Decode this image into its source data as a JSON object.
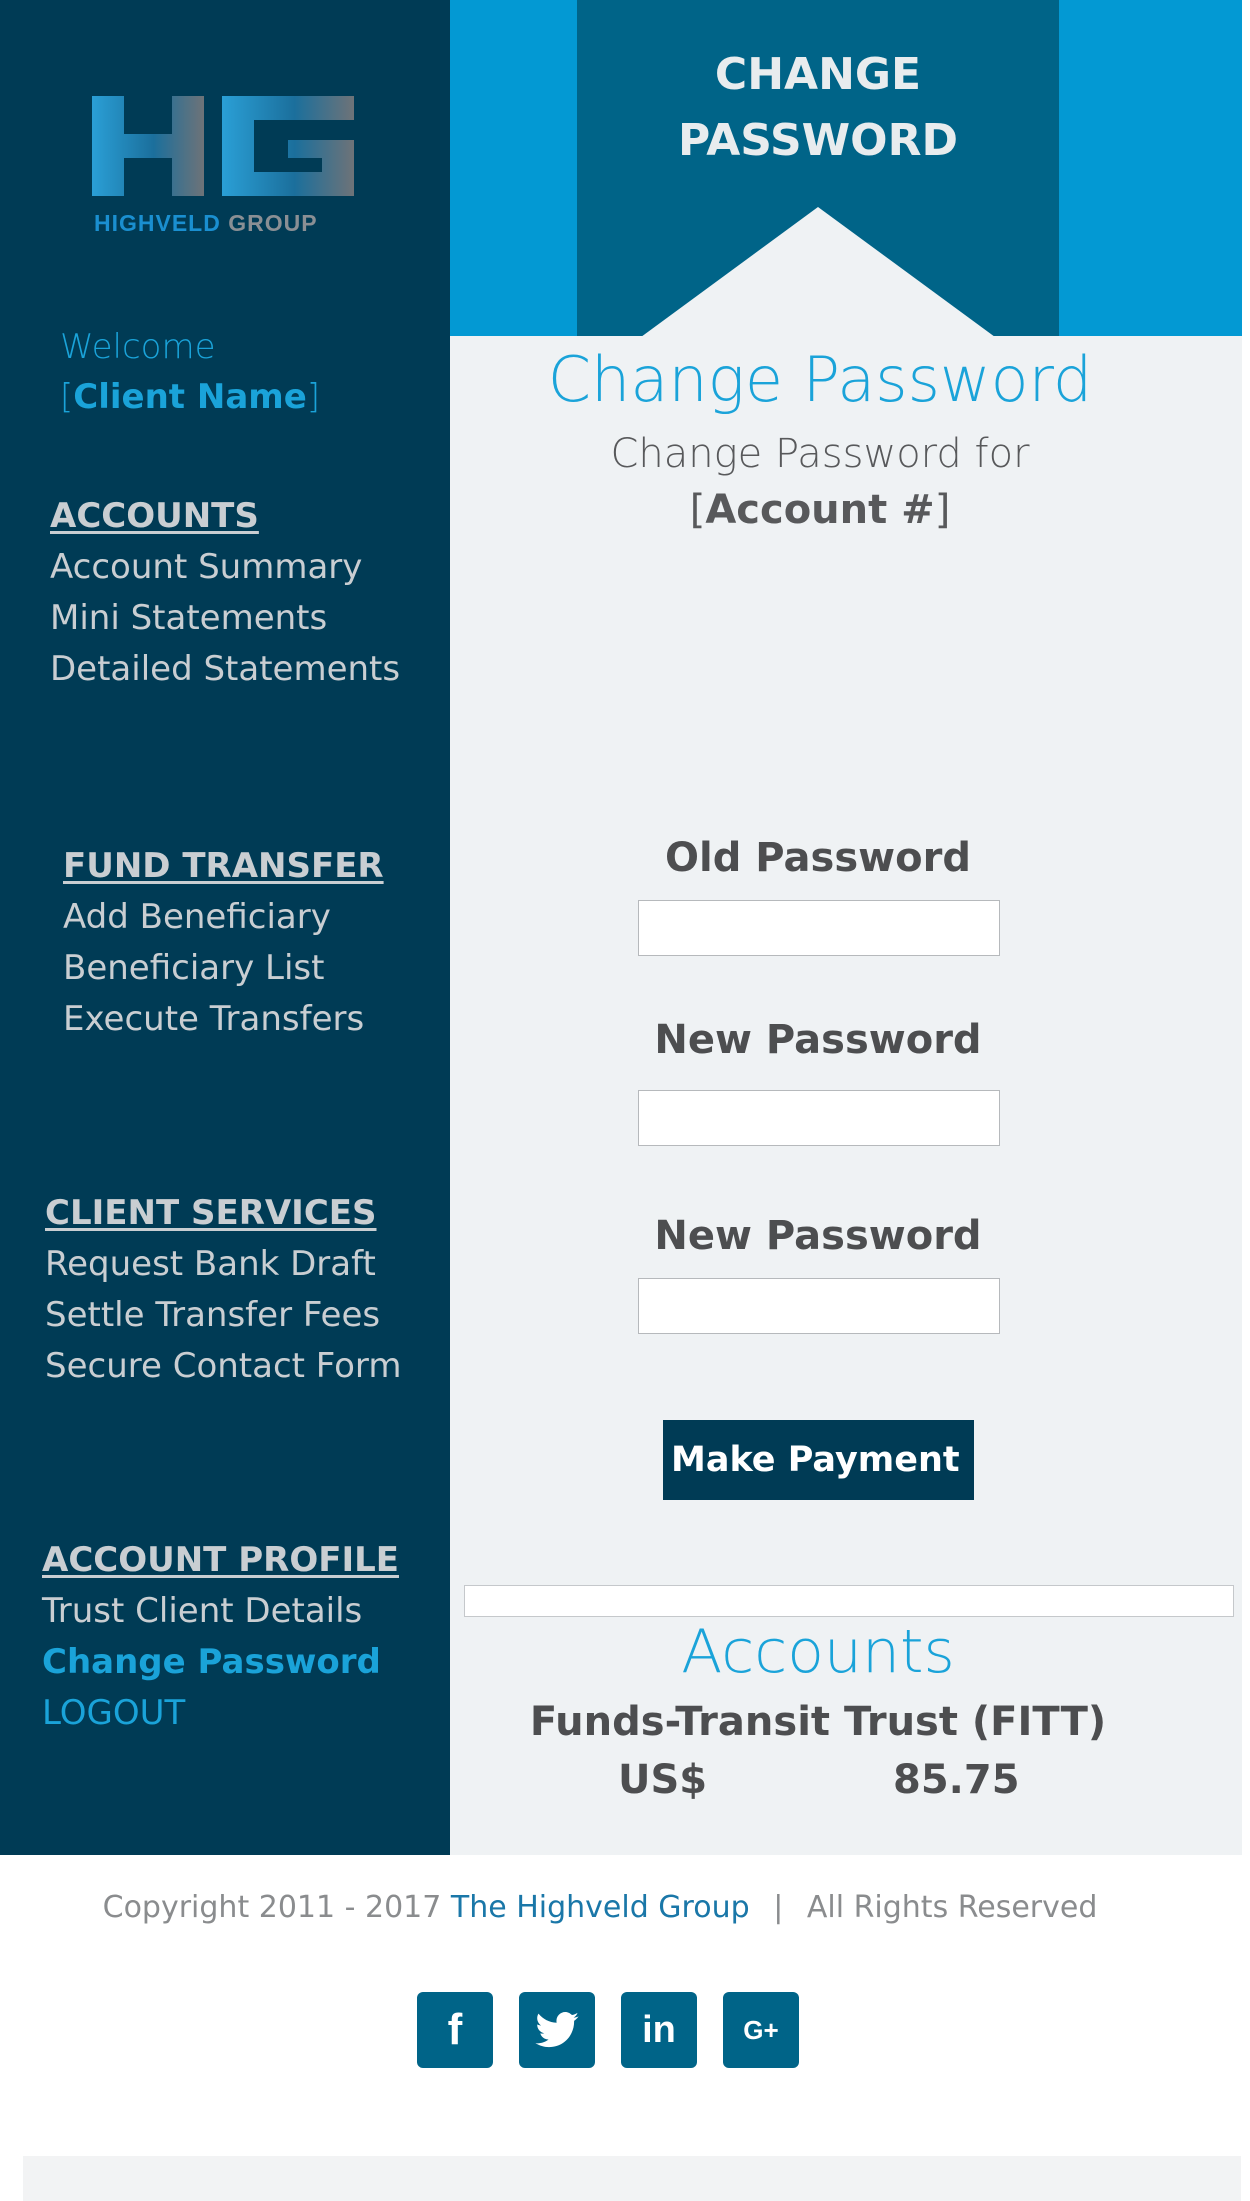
{
  "logo": {
    "brand_part1": "HIGHVELD",
    "brand_part2": "GROUP"
  },
  "welcome": {
    "greeting": "Welcome",
    "client_name": "Client Name"
  },
  "sidebar": {
    "accounts": {
      "heading": "ACCOUNTS",
      "items": [
        "Account Summary",
        "Mini Statements",
        "Detailed Statements"
      ]
    },
    "fund_transfer": {
      "heading": "FUND TRANSFER",
      "items": [
        "Add Beneficiary",
        "Beneficiary List",
        "Execute Transfers"
      ]
    },
    "client_services": {
      "heading": "CLIENT SERVICES",
      "items": [
        "Request Bank Draft",
        "Settle Transfer Fees",
        "Secure Contact Form"
      ]
    },
    "account_profile": {
      "heading": "ACCOUNT PROFILE",
      "items": [
        "Trust Client Details",
        "Change Password",
        "LOGOUT"
      ]
    }
  },
  "hero": {
    "line1": "CHANGE",
    "line2": "PASSWORD"
  },
  "main": {
    "title": "Change Password",
    "subtitle": "Change Password for",
    "account_ref": "Account #",
    "fields": {
      "old_password_label": "Old Password",
      "new_password_label": "New Password",
      "confirm_password_label": "New Password"
    },
    "submit_label": "Make Payment"
  },
  "accounts_panel": {
    "title": "Accounts",
    "fund_name": "Funds-Transit Trust (FITT)",
    "currency": "US$",
    "balance": "85.75"
  },
  "footer": {
    "copyright_prefix": "Copyright 2011 - 2017",
    "company_link": "The Highveld Group",
    "separator": "|",
    "rights": "All Rights Reserved",
    "social": [
      "f",
      "t",
      "in",
      "G+"
    ]
  },
  "colors": {
    "sidebar_bg": "#003b55",
    "accent_blue": "#1aa3d9",
    "hero_bg": "#0399d3",
    "ribbon_bg": "#006488",
    "panel_bg": "#eff2f4"
  }
}
